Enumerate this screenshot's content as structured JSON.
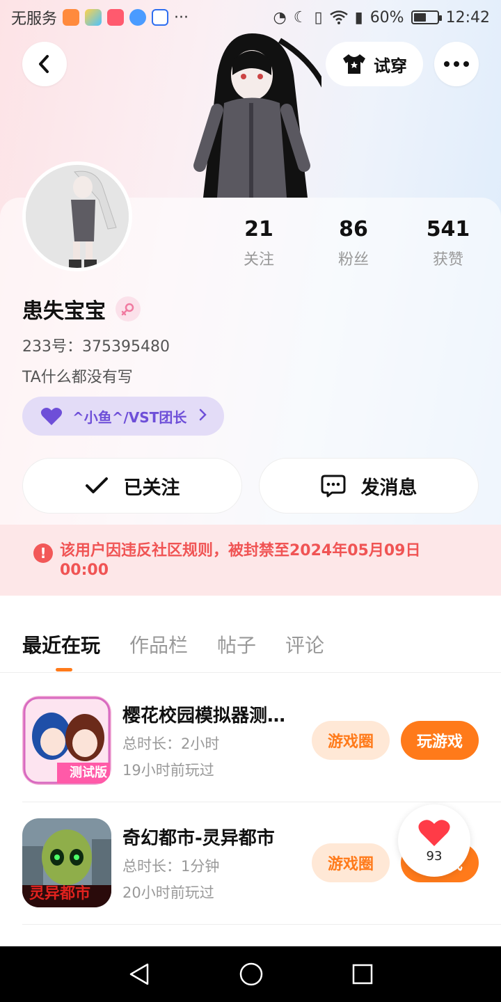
{
  "status_bar": {
    "carrier": "无服务",
    "battery": "60%",
    "time": "12:42",
    "battery_level": 0.6
  },
  "header": {
    "back_icon": "chevron-left-icon",
    "try_on_label": "试穿",
    "more_icon": "more-horizontal-icon"
  },
  "profile": {
    "name": "患失宝宝",
    "gender_icon": "female-icon",
    "uid": "233号：375395480",
    "bio": "TA什么都没有写",
    "club_label": "^小鱼^/VST团长",
    "stats": [
      {
        "num": "21",
        "label": "关注"
      },
      {
        "num": "86",
        "label": "粉丝"
      },
      {
        "num": "541",
        "label": "获赞"
      }
    ],
    "followed_label": "已关注",
    "message_label": "发消息"
  },
  "ban_notice": "该用户因违反社区规则，被封禁至2024年05月09日 00:00",
  "tabs": [
    "最近在玩",
    "作品栏",
    "帖子",
    "评论"
  ],
  "games": [
    {
      "title": "樱花校园模拟器测试版",
      "duration": "总时长：2小时",
      "last_played": "19小时前玩过",
      "circle_label": "游戏圈",
      "play_label": "玩游戏",
      "icon_text": "测试版"
    },
    {
      "title": "奇幻都市-灵异都市",
      "duration": "总时长：1分钟",
      "last_played": "20小时前玩过",
      "circle_label": "游戏圈",
      "play_label": "玩游戏",
      "icon_text": "灵异都市"
    }
  ],
  "like_count": "93",
  "colors": {
    "accent": "#ff7a1a",
    "ban_red": "#f05454",
    "club_purple": "#6e4fd8"
  }
}
